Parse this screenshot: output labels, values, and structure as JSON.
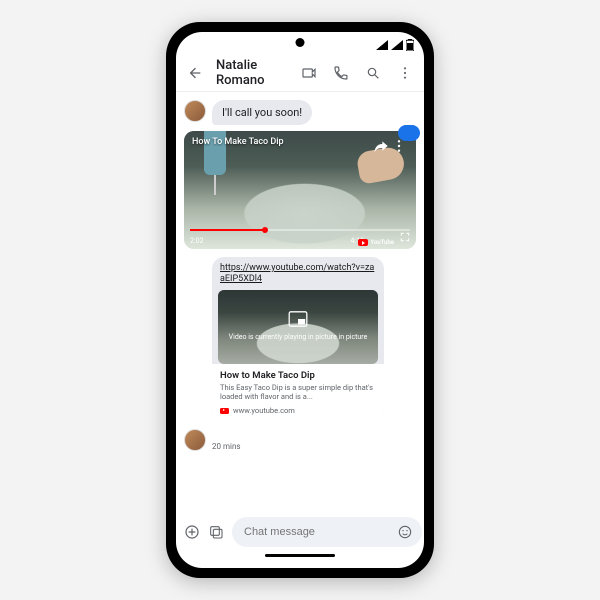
{
  "header": {
    "contact_name": "Natalie Romano"
  },
  "messages": {
    "incoming_text": "I'll call you soon!",
    "timestamp": "20 mins"
  },
  "video": {
    "title": "How To Make Taco Dip",
    "time_current": "2:02",
    "time_duration": "4:18",
    "provider": "YouTube"
  },
  "link_card": {
    "url": "https://www.youtube.com/watch?v=zaaEIP5XDl4",
    "pip_text": "Video is currently playing in picture in picture",
    "title": "How to Make Taco Dip",
    "description": "This Easy Taco Dip is a super simple dip that's loaded with flavor and is a...",
    "source": "www.youtube.com"
  },
  "composer": {
    "placeholder": "Chat message"
  }
}
